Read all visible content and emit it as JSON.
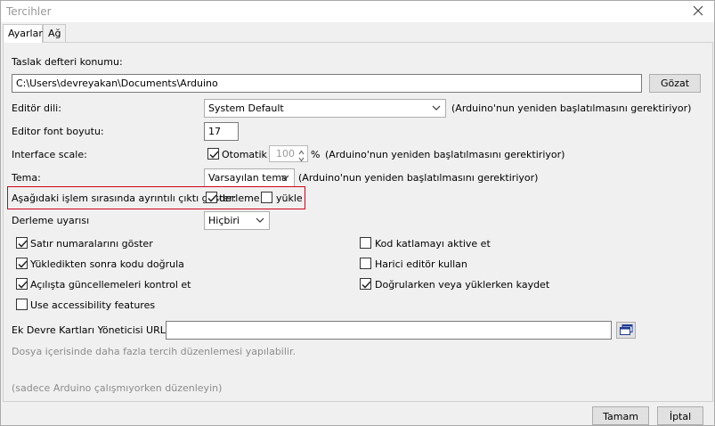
{
  "window": {
    "title": "Tercihler"
  },
  "tabs": [
    {
      "label": "Ayarlar",
      "active": true
    },
    {
      "label": "Ağ",
      "active": false
    }
  ],
  "sketchbook": {
    "label": "Taslak defteri konumu:",
    "value": "C:\\Users\\devreyakan\\Documents\\Arduino",
    "browse_label": "Gözat"
  },
  "editor_language": {
    "label": "Editör dili:",
    "value": "System Default",
    "note": "(Arduino'nun yeniden başlatılmasını gerektiriyor)"
  },
  "font_size": {
    "label": "Editor font boyutu:",
    "value": "17"
  },
  "interface_scale": {
    "label": "Interface scale:",
    "auto_label": "Otomatik",
    "auto_checked": true,
    "value": "100",
    "unit": "%",
    "note": "(Arduino'nun yeniden başlatılmasını gerektiriyor)"
  },
  "theme": {
    "label": "Tema:",
    "value": "Varsayılan tema",
    "note": "(Arduino'nun yeniden başlatılmasını gerektiriyor)"
  },
  "verbose": {
    "label": "Aşağıdaki işlem sırasında ayrıntılı çıktı göster:",
    "compile_label": "derleme",
    "compile_checked": true,
    "upload_label": "yükle",
    "upload_checked": false
  },
  "compiler_warnings": {
    "label": "Derleme uyarısı",
    "value": "Hiçbiri"
  },
  "options_left": [
    {
      "label": "Satır numaralarını göster",
      "checked": true
    },
    {
      "label": "Yükledikten sonra kodu doğrula",
      "checked": true
    },
    {
      "label": "Açılışta güncellemeleri kontrol et",
      "checked": true
    },
    {
      "label": "Use accessibility features",
      "checked": false
    }
  ],
  "options_right": [
    {
      "label": "Kod katlamayı aktive et",
      "checked": false
    },
    {
      "label": "Harici editör kullan",
      "checked": false
    },
    {
      "label": "Doğrularken veya yüklerken kaydet",
      "checked": true
    }
  ],
  "boards_url": {
    "label": "Ek Devre Kartları Yöneticisi URL'leri:",
    "value": ""
  },
  "info": {
    "more_prefs": "Dosya içerisinde daha fazla tercih düzenlemesi yapılabilir.",
    "edit_note": "(sadece Arduino çalışmıyorken düzenleyin)"
  },
  "footer": {
    "ok_label": "Tamam",
    "cancel_label": "İptal"
  },
  "icons": {
    "close": "close-icon",
    "dropdown": "chevron-down-icon",
    "check": "check-icon",
    "window": "window-icon"
  },
  "colors": {
    "highlight": "#d0021b",
    "background": "#f0f0f0"
  }
}
